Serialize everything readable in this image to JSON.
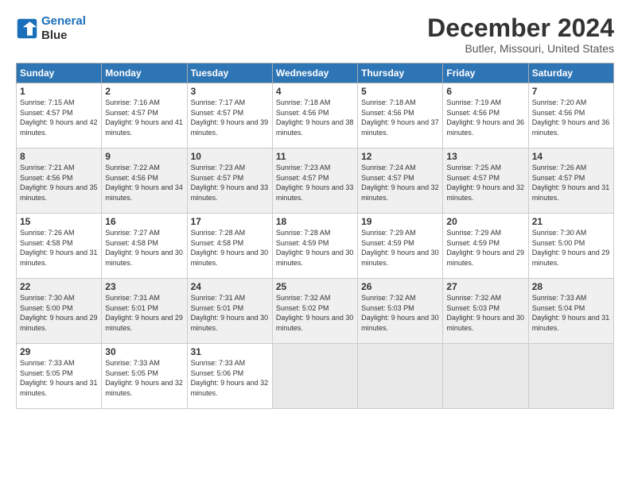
{
  "header": {
    "logo_line1": "General",
    "logo_line2": "Blue",
    "title": "December 2024",
    "subtitle": "Butler, Missouri, United States"
  },
  "weekdays": [
    "Sunday",
    "Monday",
    "Tuesday",
    "Wednesday",
    "Thursday",
    "Friday",
    "Saturday"
  ],
  "weeks": [
    [
      {
        "day": "1",
        "sunrise": "7:15 AM",
        "sunset": "4:57 PM",
        "daylight": "9 hours and 42 minutes."
      },
      {
        "day": "2",
        "sunrise": "7:16 AM",
        "sunset": "4:57 PM",
        "daylight": "9 hours and 41 minutes."
      },
      {
        "day": "3",
        "sunrise": "7:17 AM",
        "sunset": "4:57 PM",
        "daylight": "9 hours and 39 minutes."
      },
      {
        "day": "4",
        "sunrise": "7:18 AM",
        "sunset": "4:56 PM",
        "daylight": "9 hours and 38 minutes."
      },
      {
        "day": "5",
        "sunrise": "7:18 AM",
        "sunset": "4:56 PM",
        "daylight": "9 hours and 37 minutes."
      },
      {
        "day": "6",
        "sunrise": "7:19 AM",
        "sunset": "4:56 PM",
        "daylight": "9 hours and 36 minutes."
      },
      {
        "day": "7",
        "sunrise": "7:20 AM",
        "sunset": "4:56 PM",
        "daylight": "9 hours and 36 minutes."
      }
    ],
    [
      {
        "day": "8",
        "sunrise": "7:21 AM",
        "sunset": "4:56 PM",
        "daylight": "9 hours and 35 minutes."
      },
      {
        "day": "9",
        "sunrise": "7:22 AM",
        "sunset": "4:56 PM",
        "daylight": "9 hours and 34 minutes."
      },
      {
        "day": "10",
        "sunrise": "7:23 AM",
        "sunset": "4:57 PM",
        "daylight": "9 hours and 33 minutes."
      },
      {
        "day": "11",
        "sunrise": "7:23 AM",
        "sunset": "4:57 PM",
        "daylight": "9 hours and 33 minutes."
      },
      {
        "day": "12",
        "sunrise": "7:24 AM",
        "sunset": "4:57 PM",
        "daylight": "9 hours and 32 minutes."
      },
      {
        "day": "13",
        "sunrise": "7:25 AM",
        "sunset": "4:57 PM",
        "daylight": "9 hours and 32 minutes."
      },
      {
        "day": "14",
        "sunrise": "7:26 AM",
        "sunset": "4:57 PM",
        "daylight": "9 hours and 31 minutes."
      }
    ],
    [
      {
        "day": "15",
        "sunrise": "7:26 AM",
        "sunset": "4:58 PM",
        "daylight": "9 hours and 31 minutes."
      },
      {
        "day": "16",
        "sunrise": "7:27 AM",
        "sunset": "4:58 PM",
        "daylight": "9 hours and 30 minutes."
      },
      {
        "day": "17",
        "sunrise": "7:28 AM",
        "sunset": "4:58 PM",
        "daylight": "9 hours and 30 minutes."
      },
      {
        "day": "18",
        "sunrise": "7:28 AM",
        "sunset": "4:59 PM",
        "daylight": "9 hours and 30 minutes."
      },
      {
        "day": "19",
        "sunrise": "7:29 AM",
        "sunset": "4:59 PM",
        "daylight": "9 hours and 30 minutes."
      },
      {
        "day": "20",
        "sunrise": "7:29 AM",
        "sunset": "4:59 PM",
        "daylight": "9 hours and 29 minutes."
      },
      {
        "day": "21",
        "sunrise": "7:30 AM",
        "sunset": "5:00 PM",
        "daylight": "9 hours and 29 minutes."
      }
    ],
    [
      {
        "day": "22",
        "sunrise": "7:30 AM",
        "sunset": "5:00 PM",
        "daylight": "9 hours and 29 minutes."
      },
      {
        "day": "23",
        "sunrise": "7:31 AM",
        "sunset": "5:01 PM",
        "daylight": "9 hours and 29 minutes."
      },
      {
        "day": "24",
        "sunrise": "7:31 AM",
        "sunset": "5:01 PM",
        "daylight": "9 hours and 30 minutes."
      },
      {
        "day": "25",
        "sunrise": "7:32 AM",
        "sunset": "5:02 PM",
        "daylight": "9 hours and 30 minutes."
      },
      {
        "day": "26",
        "sunrise": "7:32 AM",
        "sunset": "5:03 PM",
        "daylight": "9 hours and 30 minutes."
      },
      {
        "day": "27",
        "sunrise": "7:32 AM",
        "sunset": "5:03 PM",
        "daylight": "9 hours and 30 minutes."
      },
      {
        "day": "28",
        "sunrise": "7:33 AM",
        "sunset": "5:04 PM",
        "daylight": "9 hours and 31 minutes."
      }
    ],
    [
      {
        "day": "29",
        "sunrise": "7:33 AM",
        "sunset": "5:05 PM",
        "daylight": "9 hours and 31 minutes."
      },
      {
        "day": "30",
        "sunrise": "7:33 AM",
        "sunset": "5:05 PM",
        "daylight": "9 hours and 32 minutes."
      },
      {
        "day": "31",
        "sunrise": "7:33 AM",
        "sunset": "5:06 PM",
        "daylight": "9 hours and 32 minutes."
      },
      null,
      null,
      null,
      null
    ]
  ]
}
